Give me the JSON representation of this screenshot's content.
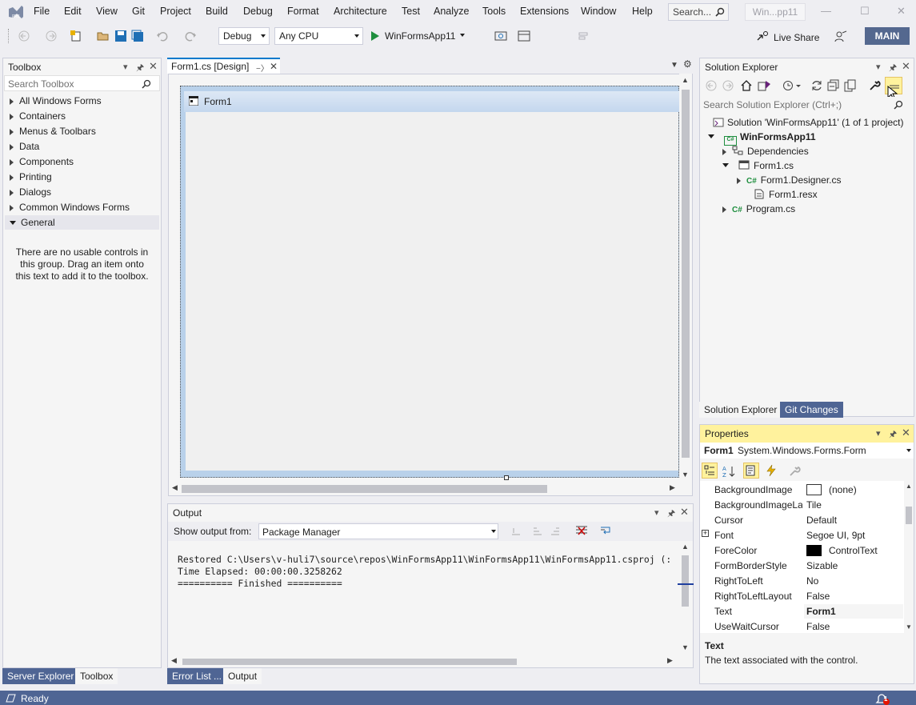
{
  "menu": {
    "items": [
      "File",
      "Edit",
      "View",
      "Git",
      "Project",
      "Build",
      "Debug",
      "Format",
      "Architecture",
      "Test",
      "Analyze",
      "Tools",
      "Extensions",
      "Window",
      "Help"
    ]
  },
  "title_search": "Search...",
  "window_title": "Win...pp11",
  "toolbar": {
    "config": "Debug",
    "platform": "Any CPU",
    "run_label": "WinFormsApp11",
    "live_share": "Live Share",
    "badge": "MAIN"
  },
  "toolbox": {
    "title": "Toolbox",
    "search_placeholder": "Search Toolbox",
    "groups": [
      "All Windows Forms",
      "Containers",
      "Menus & Toolbars",
      "Data",
      "Components",
      "Printing",
      "Dialogs",
      "Common Windows Forms"
    ],
    "open_group": "General",
    "empty_msg_1": "There are no usable controls in",
    "empty_msg_2": "this group. Drag an item onto",
    "empty_msg_3": "this text to add it to the toolbox.",
    "tabs": [
      "Server Explorer",
      "Toolbox"
    ]
  },
  "designer": {
    "tab": "Form1.cs [Design]",
    "form_title": "Form1"
  },
  "output": {
    "title": "Output",
    "show_from_label": "Show output from:",
    "source": "Package Manager",
    "lines": [
      "Restored C:\\Users\\v-huli7\\source\\repos\\WinFormsApp11\\WinFormsApp11\\WinFormsApp11.csproj (:",
      "Time Elapsed: 00:00:00.3258262",
      "========== Finished =========="
    ],
    "tabs": [
      "Error List ...",
      "Output"
    ]
  },
  "solution_explorer": {
    "title": "Solution Explorer",
    "search_placeholder": "Search Solution Explorer (Ctrl+;)",
    "solution": "Solution 'WinFormsApp11' (1 of 1 project)",
    "project": "WinFormsApp11",
    "items": [
      "Dependencies",
      "Form1.cs",
      "Form1.Designer.cs",
      "Form1.resx",
      "Program.cs"
    ],
    "tabs": [
      "Solution Explorer",
      "Git Changes"
    ]
  },
  "properties": {
    "title": "Properties",
    "object": "Form1",
    "object_type": "System.Windows.Forms.Form",
    "rows": [
      {
        "name": "BackgroundImage",
        "value": "(none)"
      },
      {
        "name": "BackgroundImageLa",
        "value": "Tile"
      },
      {
        "name": "Cursor",
        "value": "Default"
      },
      {
        "name": "Font",
        "value": "Segoe UI, 9pt"
      },
      {
        "name": "ForeColor",
        "value": "ControlText"
      },
      {
        "name": "FormBorderStyle",
        "value": "Sizable"
      },
      {
        "name": "RightToLeft",
        "value": "No"
      },
      {
        "name": "RightToLeftLayout",
        "value": "False"
      },
      {
        "name": "Text",
        "value": "Form1"
      },
      {
        "name": "UseWaitCursor",
        "value": "False"
      }
    ],
    "desc_title": "Text",
    "desc_text": "The text associated with the control."
  },
  "status": {
    "text": "Ready",
    "notif_count": "1"
  },
  "colors": {
    "accent": "#007ACC",
    "statusbar": "#4F6594",
    "badge": "#54688F",
    "highlight": "#FFF29D"
  }
}
